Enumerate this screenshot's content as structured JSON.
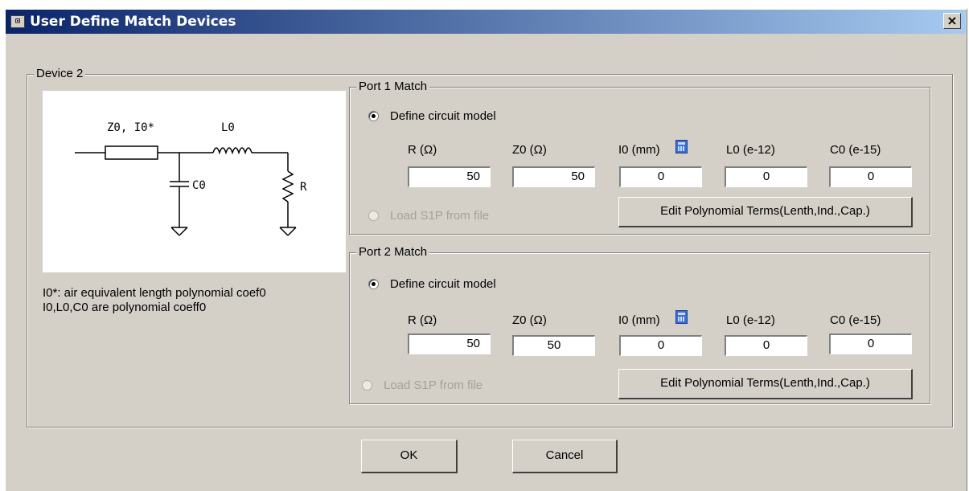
{
  "window": {
    "title": "User Define Match Devices",
    "close_label": "×",
    "icon_label": "⊡"
  },
  "device": {
    "group_label": "Device 2",
    "diagram": {
      "z0_label": "Z0, I0*",
      "l0_label": "L0",
      "c0_label": "C0",
      "r_label": "R"
    },
    "note_line1": "I0*: air equivalent length polynomial coef0",
    "note_line2": "I0,L0,C0 are polynomial coeff0"
  },
  "port1": {
    "group_label": "Port 1 Match",
    "define_label": "Define circuit model",
    "load_label": "Load S1P from file",
    "columns": [
      {
        "label": "R (Ω)",
        "value": "50"
      },
      {
        "label": "Z0 (Ω)",
        "value": "50"
      },
      {
        "label": "I0 (mm)",
        "value": "0"
      },
      {
        "label": "L0 (e-12)",
        "value": "0"
      },
      {
        "label": "C0 (e-15)",
        "value": "0"
      }
    ],
    "poly_button": "Edit Polynomial Terms(Lenth,Ind.,Cap.)"
  },
  "port2": {
    "group_label": "Port 2 Match",
    "define_label": "Define circuit model",
    "load_label": "Load S1P from file",
    "columns": [
      {
        "label": "R (Ω)",
        "value": "50"
      },
      {
        "label": "Z0 (Ω)",
        "value": "50"
      },
      {
        "label": "I0 (mm)",
        "value": "0"
      },
      {
        "label": "L0 (e-12)",
        "value": "0"
      },
      {
        "label": "C0 (e-15)",
        "value": "0"
      }
    ],
    "poly_button": "Edit Polynomial Terms(Lenth,Ind.,Cap.)"
  },
  "footer": {
    "ok_label": "OK",
    "cancel_label": "Cancel"
  }
}
